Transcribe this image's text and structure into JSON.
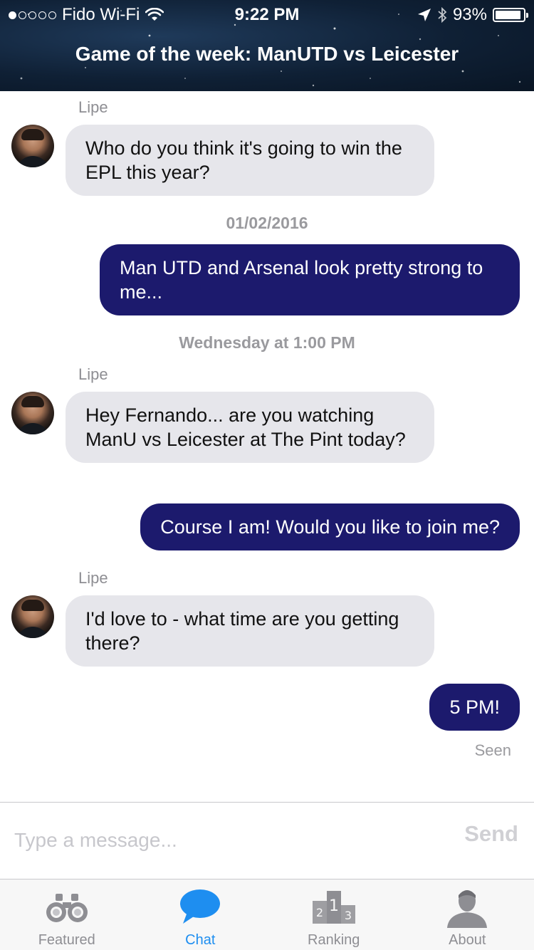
{
  "status_bar": {
    "carrier": "Fido Wi-Fi",
    "time": "9:22 PM",
    "battery": "93%",
    "battery_level": 0.93
  },
  "header": {
    "title": "Game of the week: ManUTD vs Leicester"
  },
  "messages": [
    {
      "sender": "Lipe",
      "text": "Who do you think it's going to win the EPL this year?"
    },
    {
      "date": "01/02/2016"
    },
    {
      "text": "Man UTD and Arsenal look pretty strong to me..."
    },
    {
      "date": "Wednesday at 1:00 PM"
    },
    {
      "sender": "Lipe",
      "text": "Hey Fernando... are you watching ManU vs Leicester at The Pint today?"
    },
    {
      "text": "Course I am! Would you like to join me?"
    },
    {
      "sender": "Lipe",
      "text": "I'd love to - what time are you getting there?"
    },
    {
      "text": "5 PM!"
    }
  ],
  "seen_label": "Seen",
  "composer": {
    "placeholder": "Type a message...",
    "send_label": "Send"
  },
  "tabs": [
    {
      "label": "Featured",
      "icon": "binoculars-icon"
    },
    {
      "label": "Chat",
      "icon": "chat-bubble-icon",
      "active": true
    },
    {
      "label": "Ranking",
      "icon": "podium-icon"
    },
    {
      "label": "About",
      "icon": "person-icon"
    }
  ],
  "colors": {
    "outgoing_bubble": "#1c1a6d",
    "incoming_bubble": "#e6e6eb",
    "active_tab": "#1e8ef0"
  }
}
